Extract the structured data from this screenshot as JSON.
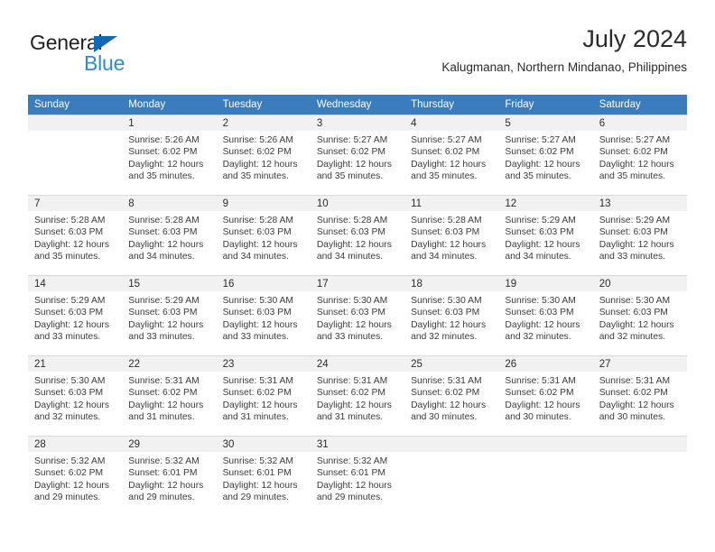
{
  "brand": {
    "name_part1": "General",
    "name_part2": "Blue",
    "triangle_color": "#1268b3",
    "blue_color": "#2e8bd4"
  },
  "header": {
    "title": "July 2024",
    "subtitle": "Kalugmanan, Northern Mindanao, Philippines"
  },
  "theme": {
    "header_row_color": "#3a7cbe",
    "daynum_band_color": "#f1f1f1",
    "grid_line_color": "#d9d9d9"
  },
  "weekdays": [
    "Sunday",
    "Monday",
    "Tuesday",
    "Wednesday",
    "Thursday",
    "Friday",
    "Saturday"
  ],
  "weeks": [
    [
      {
        "day": "",
        "lines": []
      },
      {
        "day": "1",
        "lines": [
          "Sunrise: 5:26 AM",
          "Sunset: 6:02 PM",
          "Daylight: 12 hours",
          "and 35 minutes."
        ]
      },
      {
        "day": "2",
        "lines": [
          "Sunrise: 5:26 AM",
          "Sunset: 6:02 PM",
          "Daylight: 12 hours",
          "and 35 minutes."
        ]
      },
      {
        "day": "3",
        "lines": [
          "Sunrise: 5:27 AM",
          "Sunset: 6:02 PM",
          "Daylight: 12 hours",
          "and 35 minutes."
        ]
      },
      {
        "day": "4",
        "lines": [
          "Sunrise: 5:27 AM",
          "Sunset: 6:02 PM",
          "Daylight: 12 hours",
          "and 35 minutes."
        ]
      },
      {
        "day": "5",
        "lines": [
          "Sunrise: 5:27 AM",
          "Sunset: 6:02 PM",
          "Daylight: 12 hours",
          "and 35 minutes."
        ]
      },
      {
        "day": "6",
        "lines": [
          "Sunrise: 5:27 AM",
          "Sunset: 6:02 PM",
          "Daylight: 12 hours",
          "and 35 minutes."
        ]
      }
    ],
    [
      {
        "day": "7",
        "lines": [
          "Sunrise: 5:28 AM",
          "Sunset: 6:03 PM",
          "Daylight: 12 hours",
          "and 35 minutes."
        ]
      },
      {
        "day": "8",
        "lines": [
          "Sunrise: 5:28 AM",
          "Sunset: 6:03 PM",
          "Daylight: 12 hours",
          "and 34 minutes."
        ]
      },
      {
        "day": "9",
        "lines": [
          "Sunrise: 5:28 AM",
          "Sunset: 6:03 PM",
          "Daylight: 12 hours",
          "and 34 minutes."
        ]
      },
      {
        "day": "10",
        "lines": [
          "Sunrise: 5:28 AM",
          "Sunset: 6:03 PM",
          "Daylight: 12 hours",
          "and 34 minutes."
        ]
      },
      {
        "day": "11",
        "lines": [
          "Sunrise: 5:28 AM",
          "Sunset: 6:03 PM",
          "Daylight: 12 hours",
          "and 34 minutes."
        ]
      },
      {
        "day": "12",
        "lines": [
          "Sunrise: 5:29 AM",
          "Sunset: 6:03 PM",
          "Daylight: 12 hours",
          "and 34 minutes."
        ]
      },
      {
        "day": "13",
        "lines": [
          "Sunrise: 5:29 AM",
          "Sunset: 6:03 PM",
          "Daylight: 12 hours",
          "and 33 minutes."
        ]
      }
    ],
    [
      {
        "day": "14",
        "lines": [
          "Sunrise: 5:29 AM",
          "Sunset: 6:03 PM",
          "Daylight: 12 hours",
          "and 33 minutes."
        ]
      },
      {
        "day": "15",
        "lines": [
          "Sunrise: 5:29 AM",
          "Sunset: 6:03 PM",
          "Daylight: 12 hours",
          "and 33 minutes."
        ]
      },
      {
        "day": "16",
        "lines": [
          "Sunrise: 5:30 AM",
          "Sunset: 6:03 PM",
          "Daylight: 12 hours",
          "and 33 minutes."
        ]
      },
      {
        "day": "17",
        "lines": [
          "Sunrise: 5:30 AM",
          "Sunset: 6:03 PM",
          "Daylight: 12 hours",
          "and 33 minutes."
        ]
      },
      {
        "day": "18",
        "lines": [
          "Sunrise: 5:30 AM",
          "Sunset: 6:03 PM",
          "Daylight: 12 hours",
          "and 32 minutes."
        ]
      },
      {
        "day": "19",
        "lines": [
          "Sunrise: 5:30 AM",
          "Sunset: 6:03 PM",
          "Daylight: 12 hours",
          "and 32 minutes."
        ]
      },
      {
        "day": "20",
        "lines": [
          "Sunrise: 5:30 AM",
          "Sunset: 6:03 PM",
          "Daylight: 12 hours",
          "and 32 minutes."
        ]
      }
    ],
    [
      {
        "day": "21",
        "lines": [
          "Sunrise: 5:30 AM",
          "Sunset: 6:03 PM",
          "Daylight: 12 hours",
          "and 32 minutes."
        ]
      },
      {
        "day": "22",
        "lines": [
          "Sunrise: 5:31 AM",
          "Sunset: 6:02 PM",
          "Daylight: 12 hours",
          "and 31 minutes."
        ]
      },
      {
        "day": "23",
        "lines": [
          "Sunrise: 5:31 AM",
          "Sunset: 6:02 PM",
          "Daylight: 12 hours",
          "and 31 minutes."
        ]
      },
      {
        "day": "24",
        "lines": [
          "Sunrise: 5:31 AM",
          "Sunset: 6:02 PM",
          "Daylight: 12 hours",
          "and 31 minutes."
        ]
      },
      {
        "day": "25",
        "lines": [
          "Sunrise: 5:31 AM",
          "Sunset: 6:02 PM",
          "Daylight: 12 hours",
          "and 30 minutes."
        ]
      },
      {
        "day": "26",
        "lines": [
          "Sunrise: 5:31 AM",
          "Sunset: 6:02 PM",
          "Daylight: 12 hours",
          "and 30 minutes."
        ]
      },
      {
        "day": "27",
        "lines": [
          "Sunrise: 5:31 AM",
          "Sunset: 6:02 PM",
          "Daylight: 12 hours",
          "and 30 minutes."
        ]
      }
    ],
    [
      {
        "day": "28",
        "lines": [
          "Sunrise: 5:32 AM",
          "Sunset: 6:02 PM",
          "Daylight: 12 hours",
          "and 29 minutes."
        ]
      },
      {
        "day": "29",
        "lines": [
          "Sunrise: 5:32 AM",
          "Sunset: 6:01 PM",
          "Daylight: 12 hours",
          "and 29 minutes."
        ]
      },
      {
        "day": "30",
        "lines": [
          "Sunrise: 5:32 AM",
          "Sunset: 6:01 PM",
          "Daylight: 12 hours",
          "and 29 minutes."
        ]
      },
      {
        "day": "31",
        "lines": [
          "Sunrise: 5:32 AM",
          "Sunset: 6:01 PM",
          "Daylight: 12 hours",
          "and 29 minutes."
        ]
      },
      {
        "day": "",
        "lines": []
      },
      {
        "day": "",
        "lines": []
      },
      {
        "day": "",
        "lines": []
      }
    ]
  ]
}
